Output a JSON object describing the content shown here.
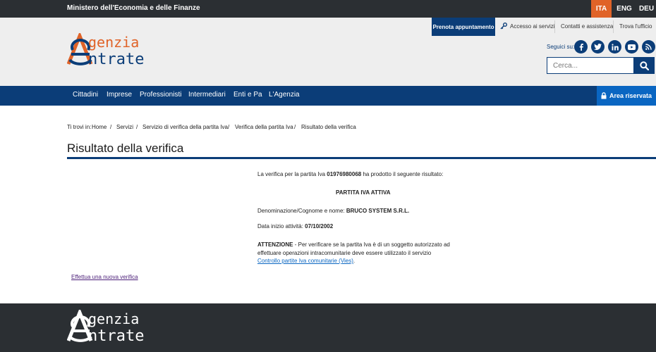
{
  "topbar": {
    "ministry": "Ministero dell'Economia e delle Finanze",
    "languages": [
      "ITA",
      "ENG",
      "DEU"
    ]
  },
  "logo": {
    "line1": "genzia",
    "line2": "ntrate"
  },
  "header": {
    "prenota": "Prenota appuntamento",
    "accesso": "Accesso ai servizi",
    "contatti": "Contatti e assistenza",
    "trova": "Trova l'ufficio",
    "seguici": "Seguici su:",
    "search_placeholder": "Cerca..."
  },
  "nav": {
    "items": [
      "Cittadini",
      "Imprese",
      "Professionisti",
      "Intermediari",
      "Enti e Pa",
      "L'Agenzia"
    ],
    "area_riservata": "Area riservata"
  },
  "breadcrumb": {
    "prefix": "Ti trovi in:",
    "items": [
      "Home",
      "Servizi",
      "Servizio di verifica della partita Iva",
      "Verifica della partita Iva",
      "Risultato della verifica"
    ],
    "separator": "/"
  },
  "page_title": "Risultato della verifica",
  "result": {
    "intro_before": "La verifica per la partita Iva",
    "piva": "01976980068",
    "intro_after": "ha prodotto il seguente risultato:",
    "status": "PARTITA IVA ATTIVA",
    "denominazione_label": "Denominazione/Cognome e nome:",
    "denominazione_value": "BRUCO SYSTEM S.R.L.",
    "data_label": "Data inizio attività:",
    "data_value": "07/10/2002",
    "attenzione_label": "ATTENZIONE",
    "attenzione_line1": "- Per verificare se la partita Iva è di un soggetto autorizzato ad",
    "attenzione_line2": "effettuare operazioni intracomunitarie deve essere utilizzato il servizio",
    "vies_link": "Controllo partite Iva comunitarie (Vies)",
    "vies_end": "."
  },
  "new_check": "Effettua una nuova verifica",
  "colors": {
    "primary": "#0b3d78",
    "accent": "#e06328",
    "dark": "#2b2f33"
  },
  "icons": [
    "key-icon",
    "facebook-icon",
    "twitter-icon",
    "linkedin-icon",
    "youtube-icon",
    "rss-icon",
    "search-icon",
    "lock-icon"
  ]
}
